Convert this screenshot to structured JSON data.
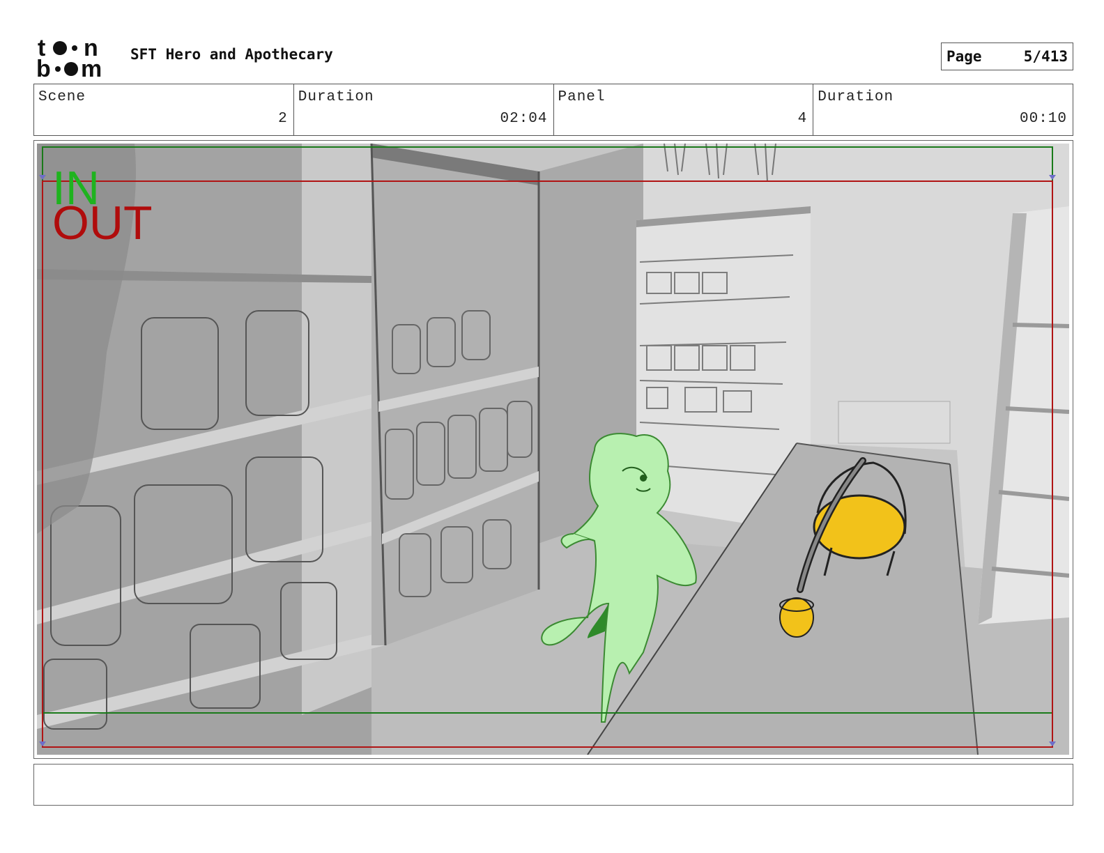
{
  "header": {
    "project_title": "SFT Hero and Apothecary",
    "page_label": "Page",
    "page_value": "5/413"
  },
  "info": [
    {
      "label": "Scene",
      "value": "2"
    },
    {
      "label": "Duration",
      "value": "02:04"
    },
    {
      "label": "Panel",
      "value": "4"
    },
    {
      "label": "Duration",
      "value": "00:10"
    }
  ],
  "panel": {
    "in_label": "IN",
    "out_label": "OUT",
    "in_color": "#1fb31f",
    "out_color": "#b00c0c"
  },
  "notes": {
    "text": ""
  }
}
